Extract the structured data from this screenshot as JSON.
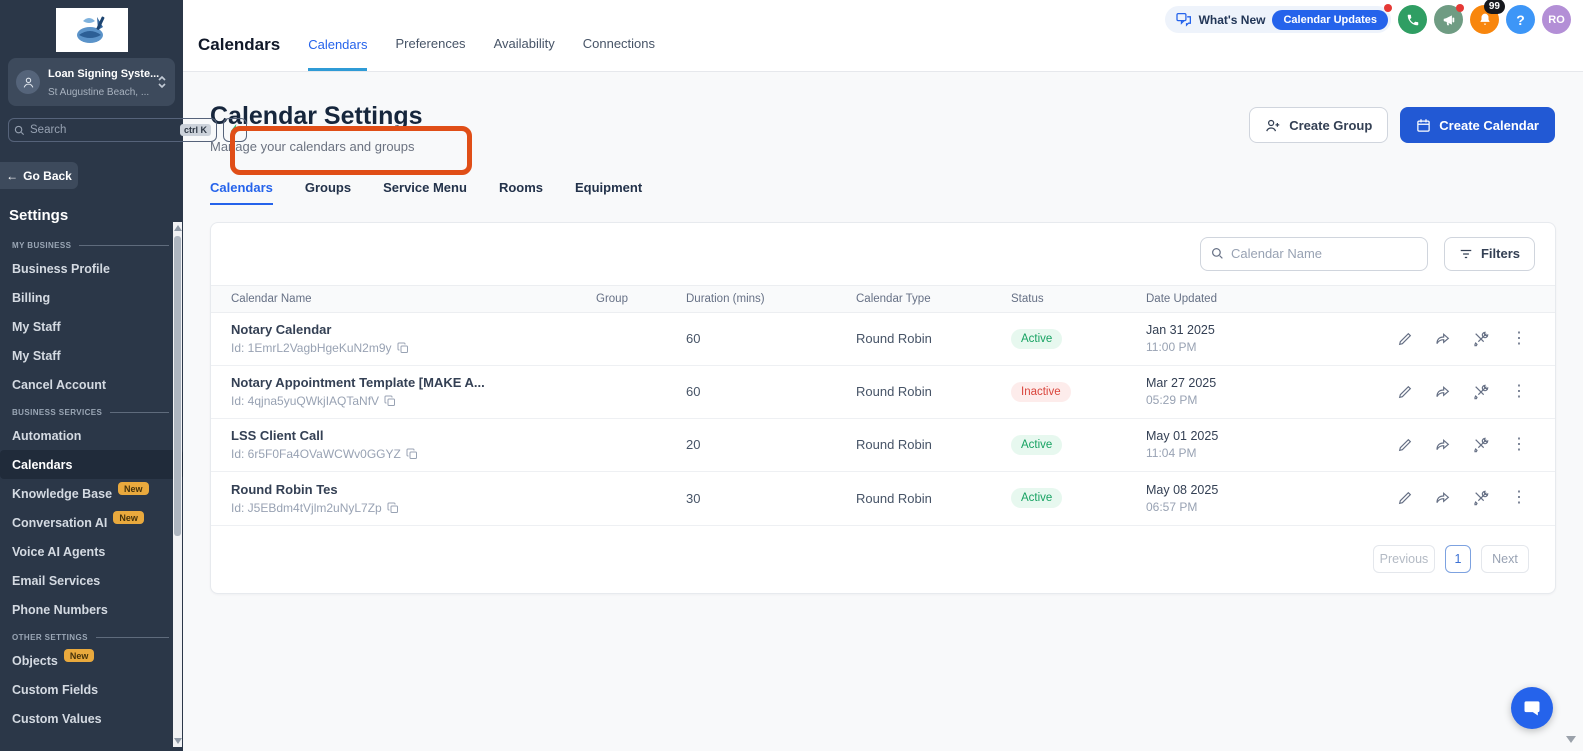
{
  "sidebar": {
    "account": {
      "name": "Loan Signing Syste...",
      "location": "St Augustine Beach, ..."
    },
    "search": {
      "placeholder": "Search",
      "shortcut": "ctrl K"
    },
    "go_back_label": "Go Back",
    "title": "Settings",
    "sections": [
      {
        "label": "MY BUSINESS",
        "items": [
          {
            "label": "Business Profile"
          },
          {
            "label": "Billing"
          },
          {
            "label": "My Staff"
          },
          {
            "label": "My Staff"
          },
          {
            "label": "Cancel Account"
          }
        ]
      },
      {
        "label": "BUSINESS SERVICES",
        "items": [
          {
            "label": "Automation"
          },
          {
            "label": "Calendars",
            "active": true
          },
          {
            "label": "Knowledge Base",
            "badge": "New"
          },
          {
            "label": "Conversation AI",
            "badge": "New"
          },
          {
            "label": "Voice AI Agents"
          },
          {
            "label": "Email Services"
          },
          {
            "label": "Phone Numbers"
          }
        ]
      },
      {
        "label": "OTHER SETTINGS",
        "items": [
          {
            "label": "Objects",
            "badge": "New"
          },
          {
            "label": "Custom Fields"
          },
          {
            "label": "Custom Values"
          }
        ]
      }
    ]
  },
  "header": {
    "title": "Calendars",
    "tabs": [
      {
        "label": "Calendars"
      },
      {
        "label": "Preferences"
      },
      {
        "label": "Availability"
      },
      {
        "label": "Connections"
      }
    ],
    "whats_new_label": "What's New",
    "calendar_updates_label": "Calendar Updates",
    "notification_count": "99",
    "help_label": "?",
    "avatar_initials": "RO"
  },
  "page": {
    "title": "Calendar Settings",
    "subtitle": "Manage your calendars and groups",
    "create_group_label": "Create Group",
    "create_calendar_label": "Create Calendar",
    "tabs": [
      {
        "label": "Calendars"
      },
      {
        "label": "Groups"
      },
      {
        "label": "Service Menu"
      },
      {
        "label": "Rooms"
      },
      {
        "label": "Equipment"
      }
    ]
  },
  "table": {
    "search_placeholder": "Calendar Name",
    "filters_label": "Filters",
    "columns": [
      "Calendar Name",
      "Group",
      "Duration (mins)",
      "Calendar Type",
      "Status",
      "Date Updated"
    ],
    "rows": [
      {
        "name": "Notary Calendar",
        "id": "Id: 1EmrL2VagbHgeKuN2m9y",
        "group": "",
        "duration": "60",
        "type": "Round Robin",
        "status": "Active",
        "date": "Jan 31 2025",
        "time": "11:00 PM"
      },
      {
        "name": "Notary Appointment Template [MAKE A...",
        "id": "Id: 4qjna5yuQWkjIAQTaNfV",
        "group": "",
        "duration": "60",
        "type": "Round Robin",
        "status": "Inactive",
        "date": "Mar 27 2025",
        "time": "05:29 PM"
      },
      {
        "name": "LSS Client Call",
        "id": "Id: 6r5F0Fa4OVaWCWv0GGYZ",
        "group": "",
        "duration": "20",
        "type": "Round Robin",
        "status": "Active",
        "date": "May 01 2025",
        "time": "11:04 PM"
      },
      {
        "name": "Round Robin Tes",
        "id": "Id: J5EBdm4tVjlm2uNyL7Zp",
        "group": "",
        "duration": "30",
        "type": "Round Robin",
        "status": "Active",
        "date": "May 08 2025",
        "time": "06:57 PM"
      }
    ],
    "pagination": {
      "previous": "Previous",
      "page": "1",
      "next": "Next"
    }
  },
  "icons": {
    "sidebar": [
      "user-avatar-icon",
      "chevron-updown-icon",
      "magnifier-icon",
      "lightning-icon",
      "back-arrow-icon"
    ],
    "header": [
      "chat-bubbles-icon",
      "phone-icon",
      "megaphone-icon",
      "bell-icon",
      "help-icon"
    ],
    "table_actions": [
      "edit-pencil-icon",
      "share-arrow-icon",
      "tools-icon",
      "kebab-menu-icon",
      "copy-icon"
    ],
    "misc": [
      "calendar-icon",
      "add-user-icon",
      "filter-lines-icon",
      "chat-widget-icon"
    ]
  },
  "colors": {
    "sidebar_bg": "#2b3748",
    "accent_blue": "#2563eb",
    "primary_button": "#2259d4",
    "annotation_orange": "#e04e17",
    "active_status": "#17a262",
    "inactive_status": "#d9453c",
    "new_badge": "#e9a93d"
  }
}
